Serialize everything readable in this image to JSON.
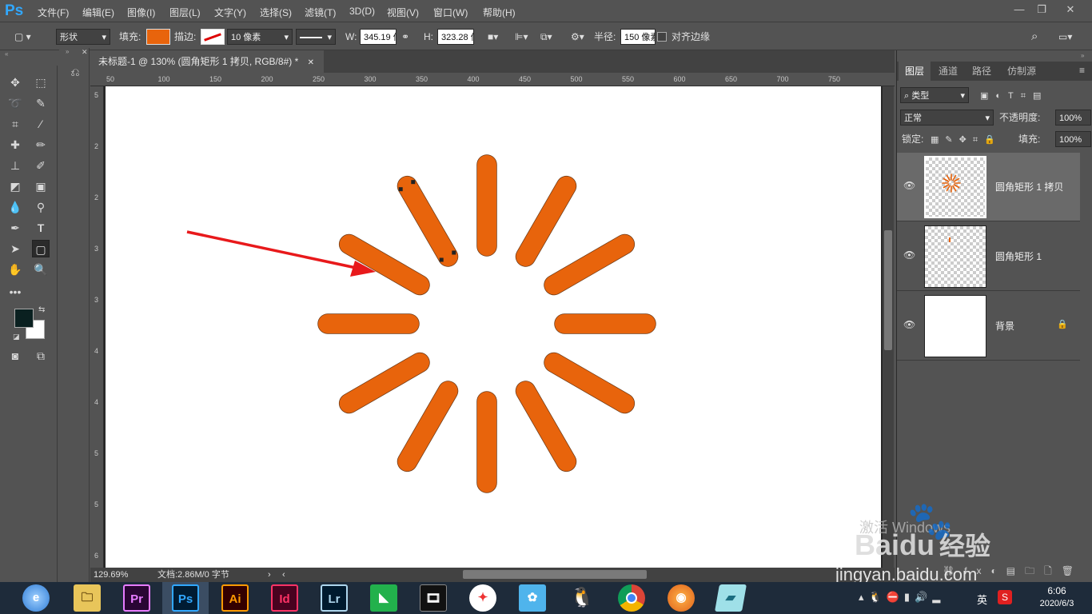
{
  "app": {
    "logo": "Ps"
  },
  "menu": [
    "文件(F)",
    "编辑(E)",
    "图像(I)",
    "图层(L)",
    "文字(Y)",
    "选择(S)",
    "滤镜(T)",
    "3D(D)",
    "视图(V)",
    "窗口(W)",
    "帮助(H)"
  ],
  "options": {
    "mode": "形状",
    "fill_label": "填充:",
    "fill_color": "#e8640c",
    "stroke_label": "描边:",
    "stroke_width": "10 像素",
    "w_label": "W:",
    "w_value": "345.19 像素",
    "h_label": "H:",
    "h_value": "323.28 像素",
    "radius_label": "半径:",
    "radius_value": "150 像素",
    "align_edges": "对齐边缘"
  },
  "document": {
    "tab_title": "未标题-1 @ 130% (圆角矩形 1 拷贝, RGB/8#) *",
    "ruler_top": [
      "50",
      "100",
      "150",
      "200",
      "250",
      "300",
      "350",
      "400",
      "450",
      "500",
      "550",
      "600",
      "650",
      "700",
      "750"
    ],
    "ruler_left": [
      "5",
      "2",
      "2",
      "3",
      "3",
      "4",
      "4",
      "5",
      "5",
      "6"
    ],
    "spinner_color": "#e8640c",
    "arrow_color": "#e8191b",
    "zoom": "129.69%",
    "doc_info": "文档:2.86M/0 字节"
  },
  "colors": {
    "foreground": "#0a2020",
    "background": "#ffffff"
  },
  "layers_panel": {
    "tabs": [
      "图层",
      "通道",
      "路径",
      "仿制源"
    ],
    "filter": "类型",
    "blend_mode": "正常",
    "opacity_label": "不透明度:",
    "opacity": "100%",
    "lock_label": "锁定:",
    "fill_label": "填充:",
    "fill": "100%",
    "layers": [
      {
        "name": "圆角矩形 1 拷贝"
      },
      {
        "name": "圆角矩形 1"
      },
      {
        "name": "背景"
      }
    ]
  },
  "taskbar": {
    "apps": [
      "edge-ie",
      "file-explorer",
      "Pr",
      "Ps",
      "Ai",
      "Id",
      "Lr",
      "xmind",
      "media",
      "photo",
      "feather",
      "qq",
      "chrome",
      "fox",
      "app"
    ],
    "ime": "英",
    "time": "6:06",
    "date": "2020/6/3"
  },
  "watermark": {
    "text1": "激活 Windows",
    "brand": "Baidu",
    "brand_cn": "经验",
    "url": "jingyan.baidu.com"
  }
}
